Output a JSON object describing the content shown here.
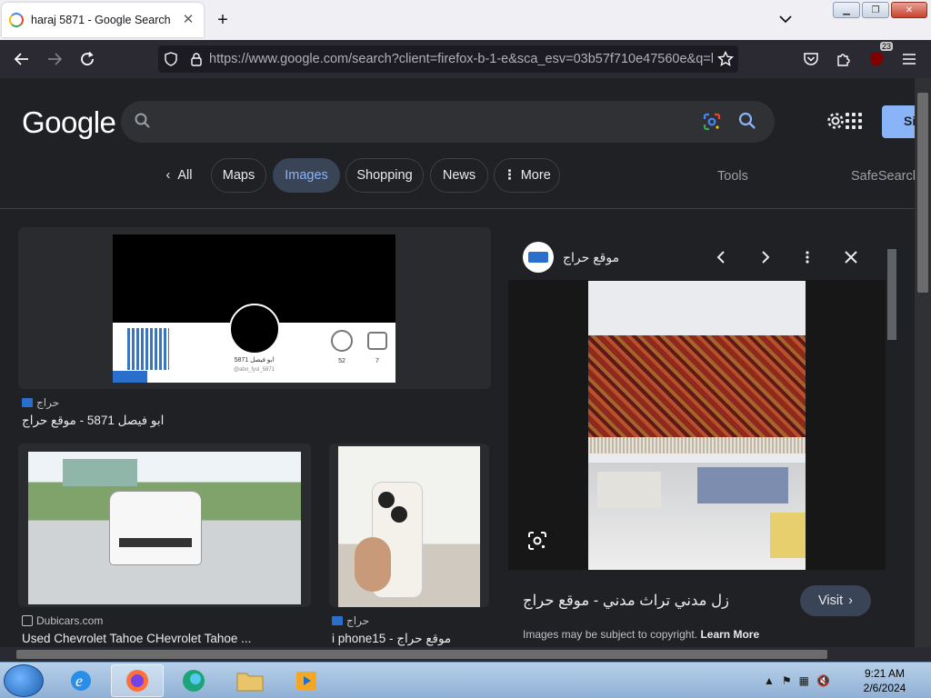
{
  "browser": {
    "tab_title": "haraj 5871 - Google Search",
    "url_host": "https://www.google.com",
    "url_path": "/search?client=firefox-b-1-e&sca_esv=03b57f710e47560e&q=h",
    "extensions_badge": "23"
  },
  "google": {
    "logo": "Google",
    "search_value": "",
    "signin_label": "Si",
    "chips": {
      "all": "All",
      "maps": "Maps",
      "images": "Images",
      "shopping": "Shopping",
      "news": "News",
      "more": "More"
    },
    "tools": "Tools",
    "safesearch": "SafeSearch"
  },
  "results": [
    {
      "source": "حراج",
      "title": "ابو فيصل 5871 - موقع حراج",
      "thumb_name": "ابو فيصل 5871",
      "thumb_handle": "@abo_fysl_5871",
      "thumb_stat1": "52",
      "thumb_stat2": "7"
    },
    {
      "source": "Dubicars.com",
      "title": "Used Chevrolet Tahoe CHevrolet Tahoe ..."
    },
    {
      "source": "حراج",
      "title": "i phone15 - موقع حراج"
    }
  ],
  "preview": {
    "site_name": "موقع حراج",
    "title": "زل مدني تراث مدني - موقع حراج",
    "visit_label": "Visit",
    "copyright_text": "Images may be subject to copyright.",
    "learn_more": "Learn More"
  },
  "taskbar": {
    "time": "9:21 AM",
    "date": "2/6/2024"
  }
}
